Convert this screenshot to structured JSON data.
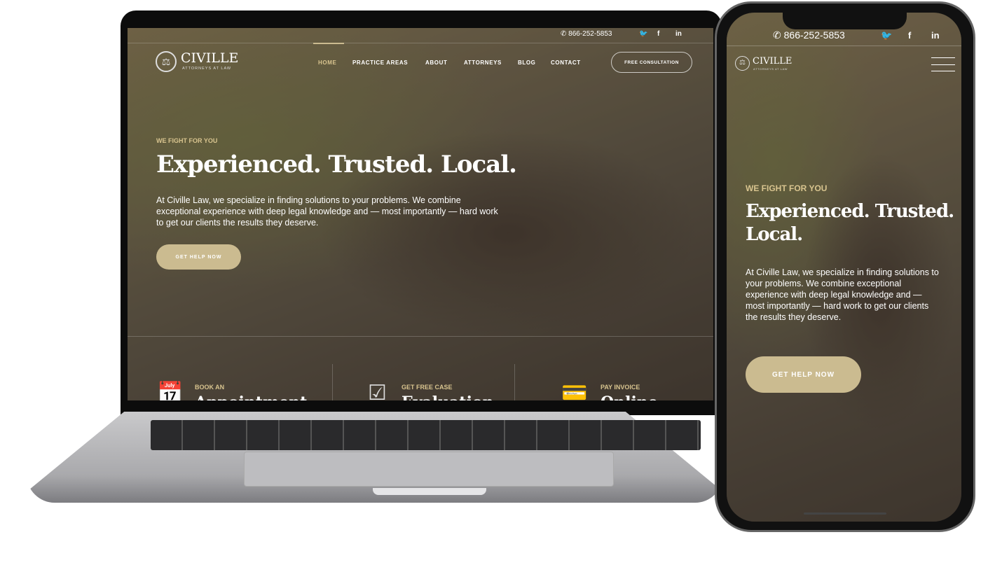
{
  "site": {
    "brand": "CIVILLE",
    "tagline": "ATTORNEYS AT LAW",
    "phone": "866-252-5853",
    "accent": "#cbbb90",
    "social": [
      {
        "icon": "twitter-icon",
        "glyph": "🐦"
      },
      {
        "icon": "facebook-icon",
        "glyph": "f"
      },
      {
        "icon": "linkedin-icon",
        "glyph": "in"
      }
    ]
  },
  "nav": {
    "items": [
      "HOME",
      "PRACTICE AREAS",
      "ABOUT",
      "ATTORNEYS",
      "BLOG",
      "CONTACT"
    ],
    "active": "HOME",
    "cta": "FREE CONSULTATION"
  },
  "hero": {
    "eyebrow": "WE FIGHT FOR YOU",
    "title": "Experienced. Trusted. Local.",
    "body": "At Civille Law, we specialize in finding solutions to your problems. We combine exceptional experience with deep legal knowledge and — most importantly — hard work to get our clients the results they deserve.",
    "button": "GET HELP NOW"
  },
  "cards": [
    {
      "icon": "calendar-icon",
      "small": "BOOK AN",
      "big": "Appointment"
    },
    {
      "icon": "checklist-icon",
      "small": "GET FREE CASE",
      "big": "Evaluation"
    },
    {
      "icon": "credit-card-icon",
      "small": "PAY INVOICE",
      "big": "Online"
    }
  ]
}
